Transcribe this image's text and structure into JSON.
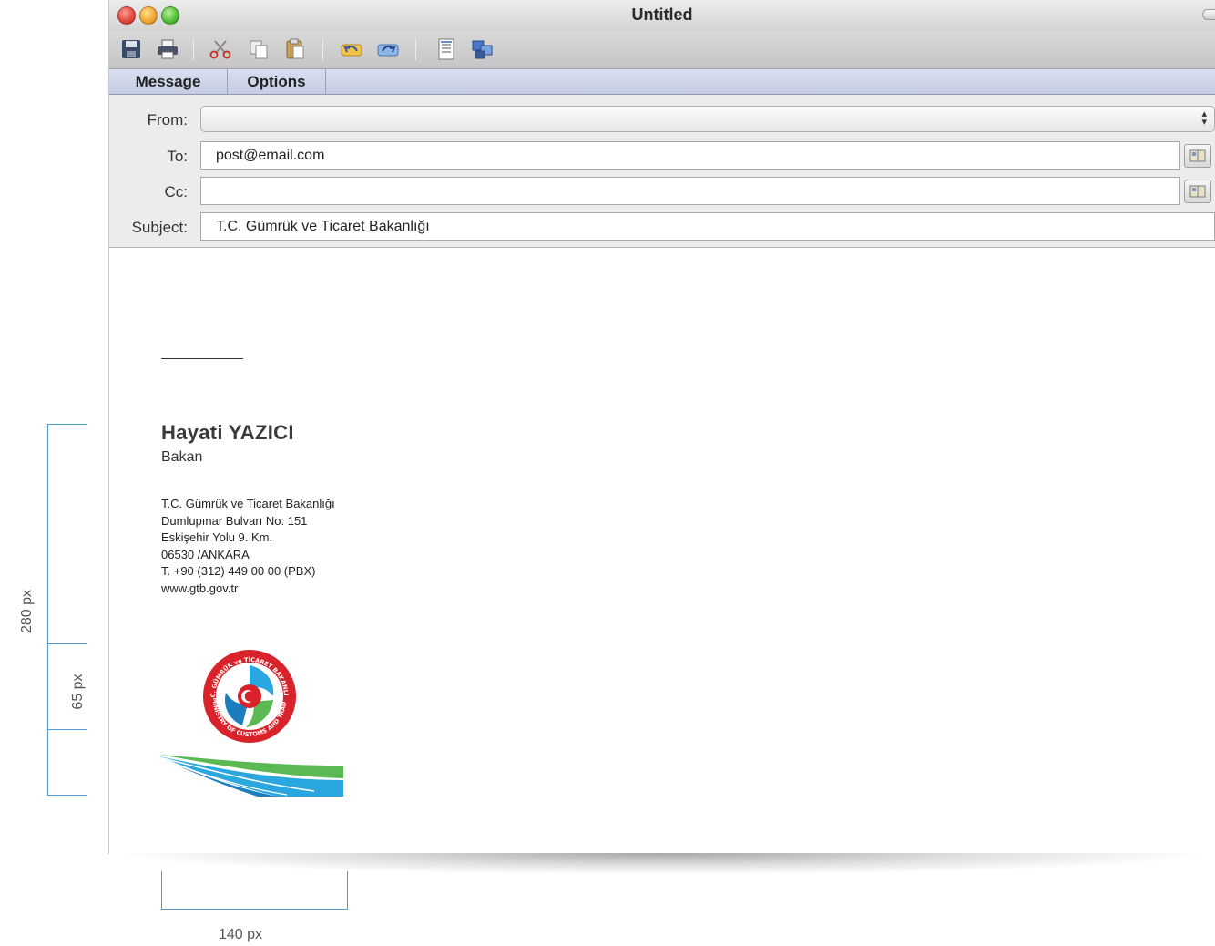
{
  "window": {
    "title": "Untitled"
  },
  "toolbar": {
    "icons": [
      "save-icon",
      "print-icon",
      "cut-icon",
      "copy-icon",
      "paste-icon",
      "undo-icon",
      "redo-icon",
      "attach-icon",
      "layout-icon"
    ]
  },
  "tabs": [
    {
      "label": "Message"
    },
    {
      "label": "Options"
    }
  ],
  "header": {
    "from_label": "From:",
    "from_value": "",
    "to_label": "To:",
    "to_value": "post@email.com",
    "cc_label": "Cc:",
    "cc_value": "",
    "subject_label": "Subject:",
    "subject_value": "T.C. Gümrük ve Ticaret Bakanlığı"
  },
  "signature": {
    "separator": "— — —",
    "name": "Hayati  YAZICI",
    "role": "Bakan",
    "address_lines": [
      "T.C. Gümrük ve Ticaret Bakanlığı",
      "Dumlupınar Bulvarı No: 151",
      "Eskişehir Yolu 9. Km.",
      "06530 /ANKARA",
      "T. +90 (312) 449 00 00 (PBX)",
      "www.gtb.gov.tr"
    ],
    "logo_text_top": "T.C. GÜMRÜK ve TİCARET BAKANLIĞI",
    "logo_text_bottom": "MINISTRY OF CUSTOMS AND TRADE"
  },
  "guides": {
    "height_total": "280 px",
    "height_logo": "65 px",
    "width": "140 px"
  },
  "colors": {
    "guide": "#4a9bd6",
    "logo_red": "#d8232a",
    "logo_blue": "#2aa7df",
    "logo_green": "#5ab952"
  }
}
